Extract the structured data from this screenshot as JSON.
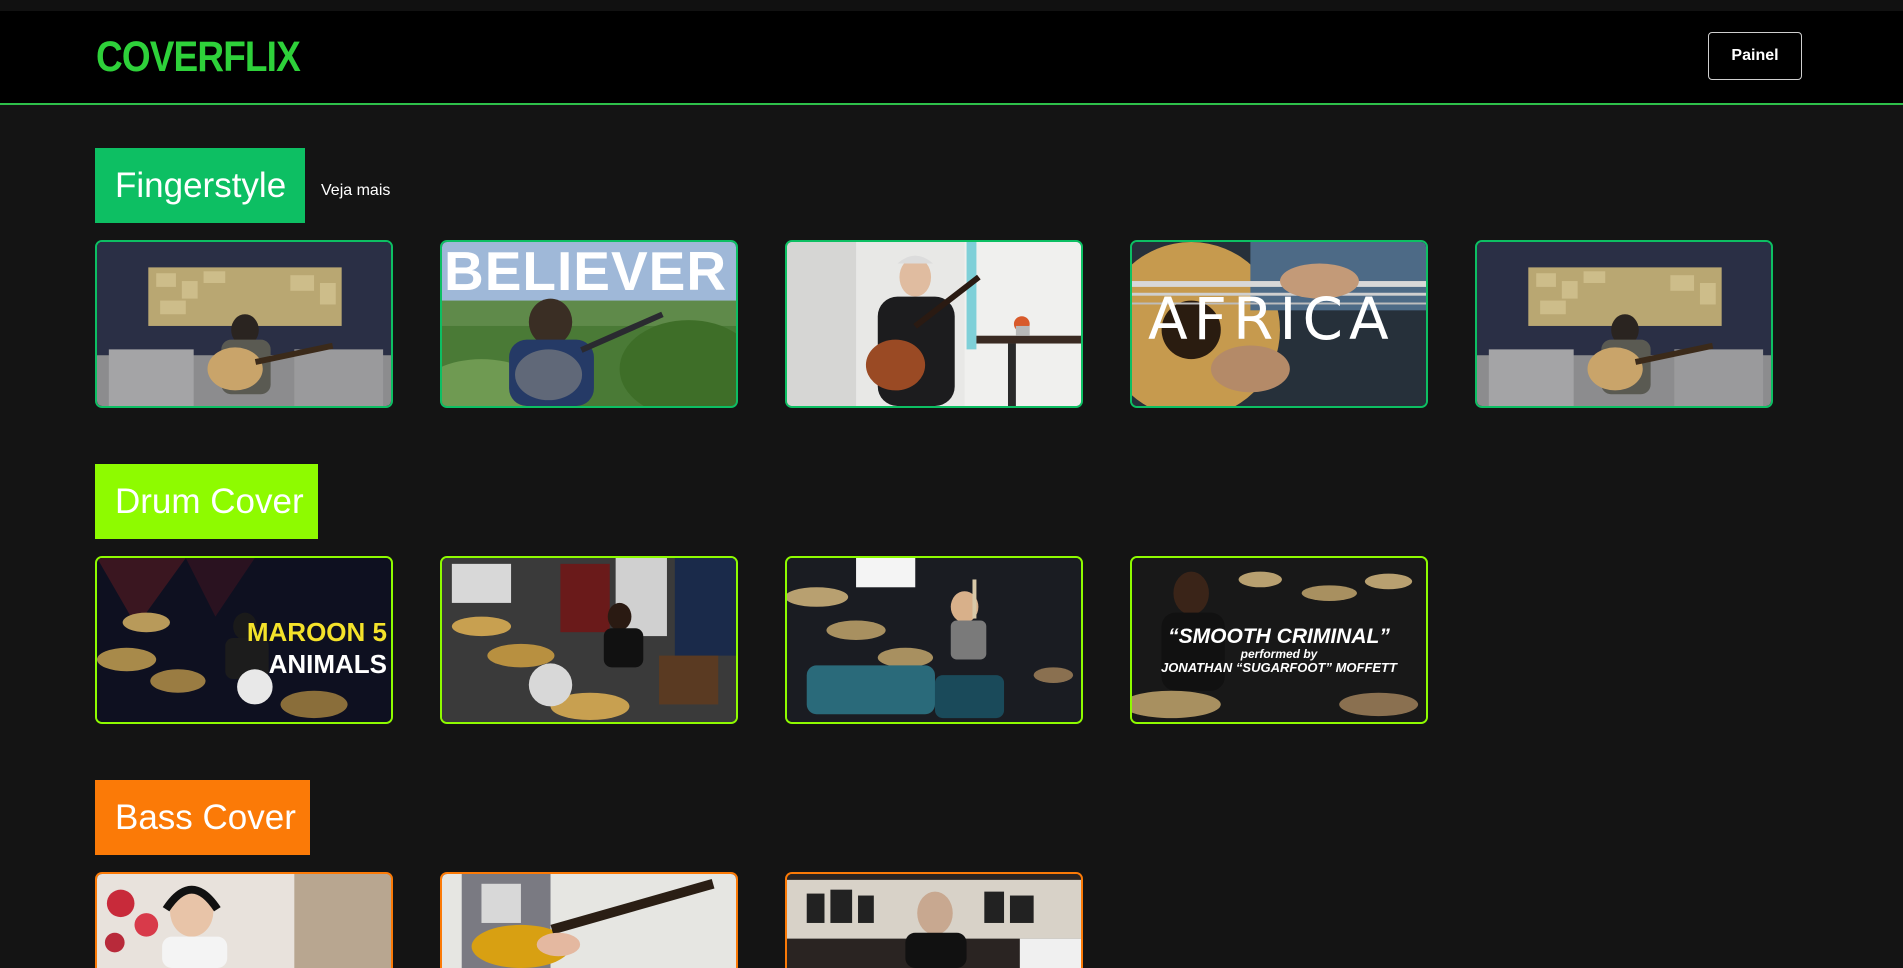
{
  "header": {
    "logo": "COVERFLIX",
    "panel_button": "Painel"
  },
  "colors": {
    "brand": "#2ed13a",
    "fingerstyle": "#0dbf63",
    "drum": "#8efb00",
    "bass": "#fb7a07"
  },
  "categories": [
    {
      "title": "Fingerstyle",
      "see_more": "Veja mais",
      "videos": [
        {
          "thumb": "guitarist-studio-icon"
        },
        {
          "thumb": "believer-icon",
          "overlay": "BELIEVER"
        },
        {
          "thumb": "classical-guitarist-icon"
        },
        {
          "thumb": "africa-guitar-icon",
          "overlay": "AFRICA"
        },
        {
          "thumb": "guitarist-studio-icon"
        }
      ]
    },
    {
      "title": "Drum Cover",
      "videos": [
        {
          "thumb": "drummer-maroon-icon",
          "overlay_1": "MAROON 5",
          "overlay_2": "ANIMALS"
        },
        {
          "thumb": "drummer-room-icon"
        },
        {
          "thumb": "drummer-studio-icon"
        },
        {
          "thumb": "drummer-smooth-icon",
          "overlay_1": "“SMOOTH CRIMINAL”",
          "overlay_2": "performed by",
          "overlay_3": "JONATHAN “SUGARFOOT” MOFFETT"
        }
      ]
    },
    {
      "title": "Bass Cover",
      "videos": [
        {
          "thumb": "bassist-headphones-icon"
        },
        {
          "thumb": "bass-closeup-icon"
        },
        {
          "thumb": "bassist-graffiti-icon"
        }
      ]
    }
  ]
}
